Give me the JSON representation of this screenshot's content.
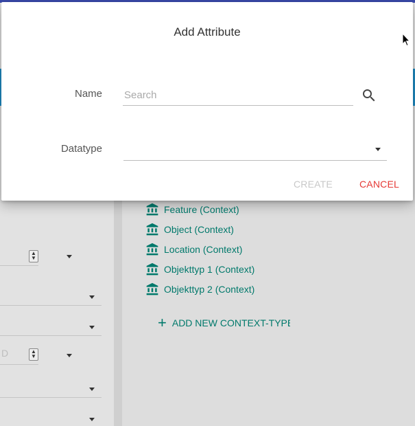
{
  "dialog": {
    "title": "Add Attribute",
    "name_label": "Name",
    "name_value": "",
    "name_placeholder": "Search",
    "datatype_label": "Datatype",
    "datatype_value": "",
    "create_label": "CREATE",
    "cancel_label": "CANCEL",
    "create_enabled": false
  },
  "background": {
    "left_faded_value": "D",
    "context_types": [
      {
        "label": "Feature (Context)",
        "icon": "bank-icon"
      },
      {
        "label": "Object (Context)",
        "icon": "bank-icon"
      },
      {
        "label": "Location (Context)",
        "icon": "bank-icon"
      },
      {
        "label": "Objekttyp 1 (Context)",
        "icon": "bank-icon"
      },
      {
        "label": "Objekttyp 2 (Context)",
        "icon": "bank-icon"
      }
    ],
    "add_context_type_label": "ADD NEW CONTEXT-TYPE"
  },
  "colors": {
    "accent_teal": "#00796b",
    "cancel_red": "#e53935",
    "disabled_grey": "#c8c8c8",
    "header_blue": "#1e8fc7"
  }
}
